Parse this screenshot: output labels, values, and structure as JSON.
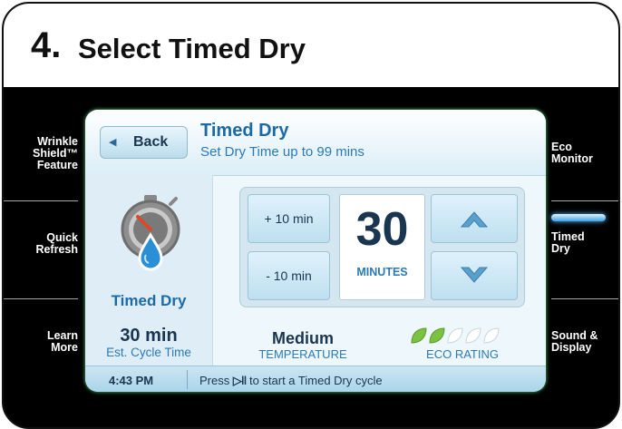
{
  "header": {
    "step_number": "4.",
    "title": "Select Timed Dry"
  },
  "left_panel": {
    "items": [
      {
        "lines": [
          "Wrinkle",
          "Shield™",
          "Feature"
        ]
      },
      {
        "lines": [
          "Quick",
          "Refresh"
        ]
      },
      {
        "lines": [
          "Learn",
          "More"
        ]
      }
    ]
  },
  "right_panel": {
    "items": [
      {
        "lines": [
          "Eco",
          "Monitor"
        ]
      },
      {
        "lines": [
          "Timed",
          "Dry"
        ],
        "active": true
      },
      {
        "lines": [
          "Sound &",
          "Display"
        ]
      }
    ]
  },
  "screen": {
    "back_label": "Back",
    "title": "Timed Dry",
    "subtitle": "Set Dry Time up to 99 mins",
    "cycle": {
      "name": "Timed Dry",
      "time": "30 min",
      "time_label": "Est. Cycle Time"
    },
    "controls": {
      "plus_label": "+ 10 min",
      "minus_label": "- 10 min",
      "value": "30",
      "unit": "MINUTES"
    },
    "temperature": {
      "value": "Medium",
      "label": "TEMPERATURE"
    },
    "eco": {
      "rating": 2,
      "max": 5,
      "label": "ECO RATING"
    },
    "status": {
      "time": "4:43 PM",
      "message_before": "Press",
      "message_icon": "play-pause-icon",
      "message_after": "to start a Timed Dry cycle"
    }
  },
  "colors": {
    "accent": "#1a6aa8",
    "dark_text": "#1a3550",
    "leaf_on": "#7cc242",
    "leaf_off": "#ffffff"
  }
}
